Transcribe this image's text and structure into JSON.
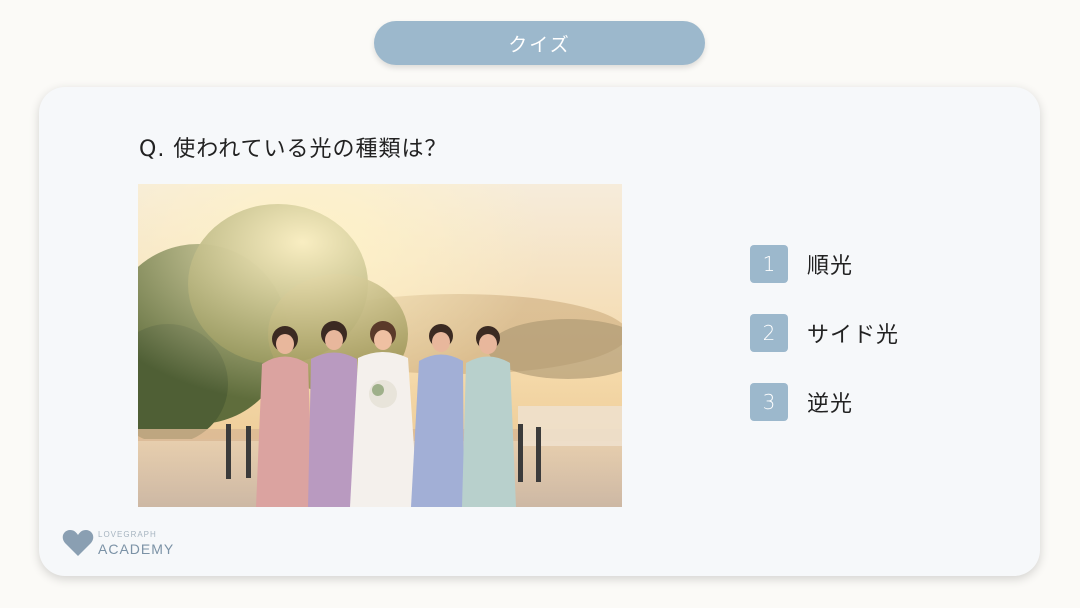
{
  "header": {
    "quiz_label": "クイズ"
  },
  "question": {
    "text": "Q. 使われている光の種類は？"
  },
  "options": [
    {
      "number": "1",
      "label": "順光"
    },
    {
      "number": "2",
      "label": "サイド光"
    },
    {
      "number": "3",
      "label": "逆光"
    }
  ],
  "logo": {
    "top_text": "LOVEGRAPH",
    "bottom_text": "ACADEMY"
  },
  "colors": {
    "accent": "#9cb8cc",
    "background": "#fbfaf7",
    "card": "#f6f8fa",
    "logo": "#7b92a6"
  }
}
